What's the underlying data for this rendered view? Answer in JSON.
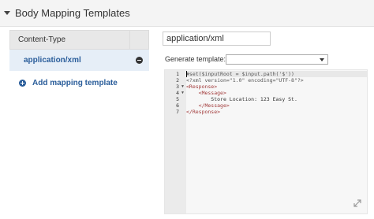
{
  "section": {
    "title": "Body Mapping Templates",
    "icon": "caret-down-icon"
  },
  "content_type_table": {
    "header": "Content-Type",
    "rows": [
      {
        "label": "application/xml",
        "action_icon": "remove-circle-icon"
      }
    ],
    "add_label": "Add mapping template",
    "add_icon": "plus-circle-icon"
  },
  "editor_panel": {
    "content_type_value": "application/xml",
    "generate_label": "Generate template:",
    "generate_selected": ""
  },
  "code_editor": {
    "lines": [
      {
        "num": "1",
        "fold": "",
        "text": "#set($inputRoot = $input.path('$'))"
      },
      {
        "num": "2",
        "fold": "",
        "text": "<?xml version=\"1.0\" encoding=\"UTF-8\"?>"
      },
      {
        "num": "3",
        "fold": "▼",
        "text": "<Response>"
      },
      {
        "num": "4",
        "fold": "▼",
        "text": "    <Message>"
      },
      {
        "num": "5",
        "fold": "",
        "text": "        Store Location: 123 Easy St."
      },
      {
        "num": "6",
        "fold": "",
        "text": "    </Message>"
      },
      {
        "num": "7",
        "fold": "",
        "text": "</Response>"
      }
    ],
    "resize_icon": "resize-handle-icon"
  },
  "colors": {
    "accent": "#2a5d9a",
    "selected_row": "#e6eef7",
    "xml_tag": "#a23b3b"
  }
}
